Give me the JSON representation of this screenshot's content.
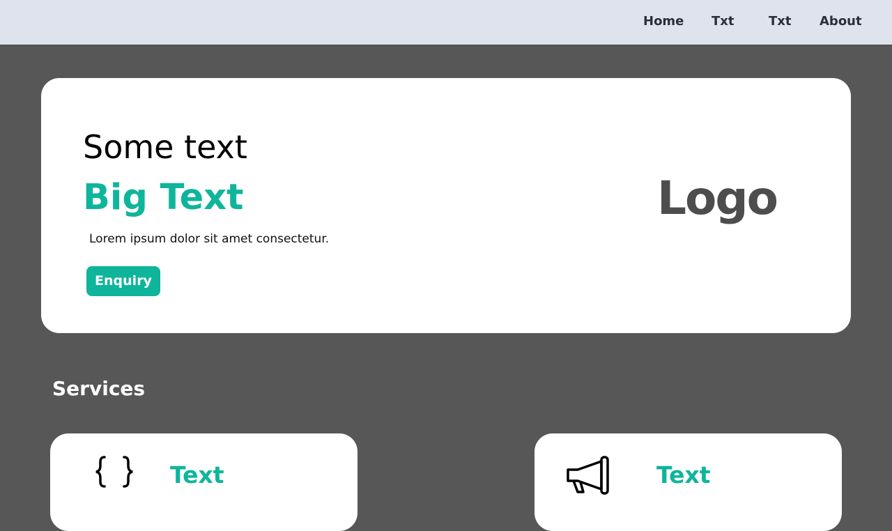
{
  "nav": {
    "items": [
      "Home",
      "Txt",
      "Txt",
      "About"
    ]
  },
  "hero": {
    "subtitle": "Some text",
    "big_text": "Big Text",
    "paragraph": "Lorem ipsum dolor sit amet consectetur.",
    "button_label": "Enquiry",
    "logo_text": "Logo"
  },
  "services": {
    "heading": "Services",
    "cards": [
      {
        "icon": "code-braces-icon",
        "title": "Text"
      },
      {
        "icon": "megaphone-icon",
        "title": "Text"
      }
    ]
  },
  "colors": {
    "background": "#575757",
    "topbar": "#dee3ed",
    "accent": "#0fb59b",
    "card": "#ffffff",
    "logo": "#4d4d4d"
  }
}
